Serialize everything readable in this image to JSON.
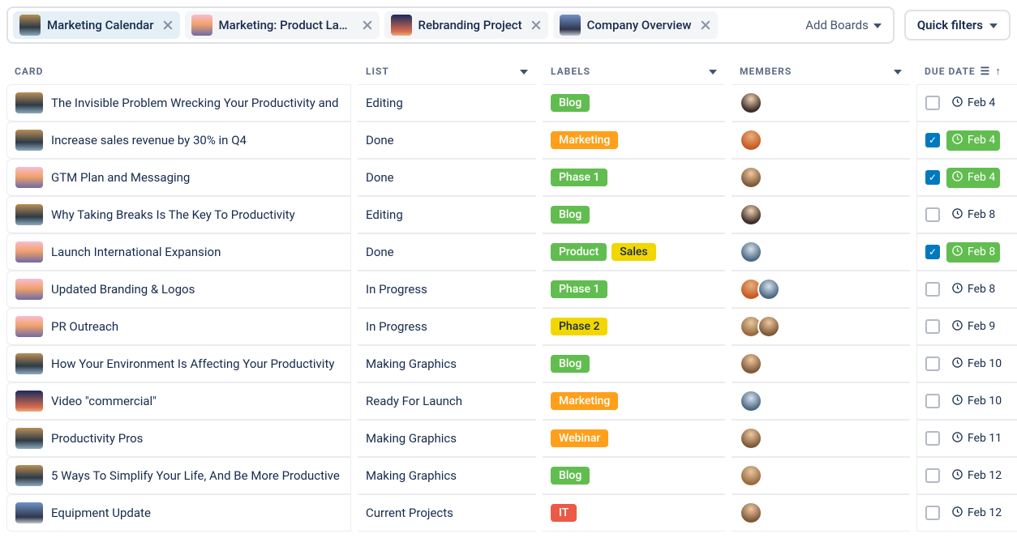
{
  "header": {
    "boards": [
      {
        "label": "Marketing Calendar",
        "thumb": "g1"
      },
      {
        "label": "Marketing: Product Lau…",
        "thumb": "g2"
      },
      {
        "label": "Rebranding Project",
        "thumb": "g3"
      },
      {
        "label": "Company Overview",
        "thumb": "g4"
      }
    ],
    "add_boards_label": "Add Boards",
    "quick_filters_label": "Quick filters"
  },
  "columns": {
    "card": "CARD",
    "list": "LIST",
    "labels": "LABELS",
    "members": "MEMBERS",
    "due_date": "DUE DATE"
  },
  "label_colors": {
    "Blog": "#61BD4F",
    "Marketing": "#FF9F1A",
    "Phase 1": "#61BD4F",
    "Product": "#61BD4F",
    "Sales": "#F2D600",
    "Phase 2": "#F2D600",
    "Webinar": "#FF9F1A",
    "IT": "#EB5A46"
  },
  "rows": [
    {
      "cover": "g1",
      "title": "The Invisible Problem Wrecking Your Productivity and",
      "list": "Editing",
      "labels": [
        "Blog"
      ],
      "members": [
        "avA"
      ],
      "done": false,
      "due": "Feb 4",
      "due_green": false
    },
    {
      "cover": "g1",
      "title": "Increase sales revenue by 30% in Q4",
      "list": "Done",
      "labels": [
        "Marketing"
      ],
      "members": [
        "avB"
      ],
      "done": true,
      "due": "Feb 4",
      "due_green": true
    },
    {
      "cover": "g2",
      "title": "GTM Plan and Messaging",
      "list": "Done",
      "labels": [
        "Phase 1"
      ],
      "members": [
        "avC"
      ],
      "done": true,
      "due": "Feb 4",
      "due_green": true
    },
    {
      "cover": "g1",
      "title": "Why Taking Breaks Is The Key To Productivity",
      "list": "Editing",
      "labels": [
        "Blog"
      ],
      "members": [
        "avA"
      ],
      "done": false,
      "due": "Feb 8",
      "due_green": false
    },
    {
      "cover": "g2",
      "title": "Launch International Expansion",
      "list": "Done",
      "labels": [
        "Product",
        "Sales"
      ],
      "members": [
        "avD"
      ],
      "done": true,
      "due": "Feb 8",
      "due_green": true
    },
    {
      "cover": "g2",
      "title": "Updated Branding & Logos",
      "list": "In Progress",
      "labels": [
        "Phase 1"
      ],
      "members": [
        "avB",
        "avD"
      ],
      "done": false,
      "due": "Feb 8",
      "due_green": false
    },
    {
      "cover": "g2",
      "title": "PR Outreach",
      "list": "In Progress",
      "labels": [
        "Phase 2"
      ],
      "members": [
        "avE",
        "avC"
      ],
      "done": false,
      "due": "Feb 9",
      "due_green": false
    },
    {
      "cover": "g1",
      "title": "How Your Environment Is Affecting Your Productivity",
      "list": "Making Graphics",
      "labels": [
        "Blog"
      ],
      "members": [
        "avC"
      ],
      "done": false,
      "due": "Feb 10",
      "due_green": false
    },
    {
      "cover": "g3",
      "title": "Video \"commercial\"",
      "list": "Ready For Launch",
      "labels": [
        "Marketing"
      ],
      "members": [
        "avD"
      ],
      "done": false,
      "due": "Feb 10",
      "due_green": false
    },
    {
      "cover": "g1",
      "title": "Productivity Pros",
      "list": "Making Graphics",
      "labels": [
        "Webinar"
      ],
      "members": [
        "avC"
      ],
      "done": false,
      "due": "Feb 11",
      "due_green": false
    },
    {
      "cover": "g1",
      "title": "5 Ways To Simplify Your Life, And Be More Productive",
      "list": "Making Graphics",
      "labels": [
        "Blog"
      ],
      "members": [
        "avE"
      ],
      "done": false,
      "due": "Feb 12",
      "due_green": false
    },
    {
      "cover": "g4",
      "title": "Equipment Update",
      "list": "Current Projects",
      "labels": [
        "IT"
      ],
      "members": [
        "avC"
      ],
      "done": false,
      "due": "Feb 12",
      "due_green": false
    }
  ]
}
